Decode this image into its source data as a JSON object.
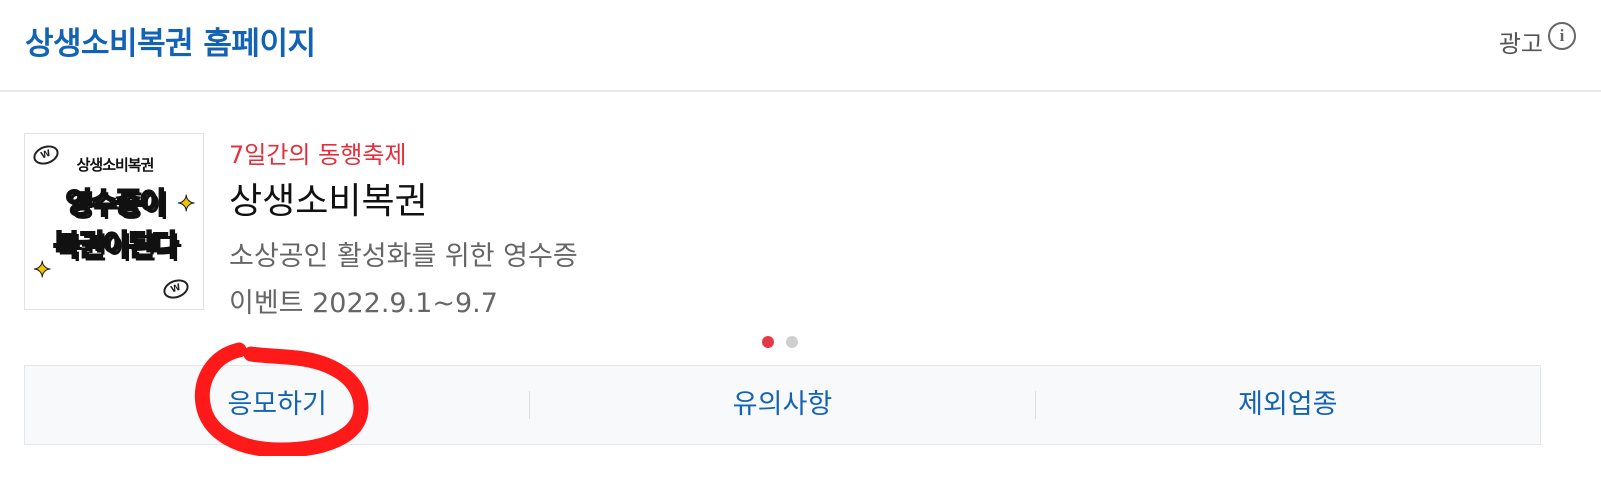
{
  "header": {
    "title": "상생소비복권 홈페이지",
    "ad_label": "광고",
    "info_icon": "info-icon"
  },
  "promo": {
    "thumbnail": {
      "small_text": "상생소비복권",
      "line1": "영수증이",
      "line2": "복권이된다"
    },
    "subtitle": "7일간의 동행축제",
    "title": "상생소비복권",
    "description": "소상공인 활성화를 위한 영수증",
    "date": "이벤트 2022.9.1~9.7",
    "pagination": {
      "total": 2,
      "active": 1
    }
  },
  "buttons": [
    {
      "label": "응모하기"
    },
    {
      "label": "유의사항"
    },
    {
      "label": "제외업종"
    }
  ],
  "colors": {
    "brand_blue": "#1363b5",
    "accent_red": "#e3303c",
    "annotation_red": "#ff1a1a"
  }
}
